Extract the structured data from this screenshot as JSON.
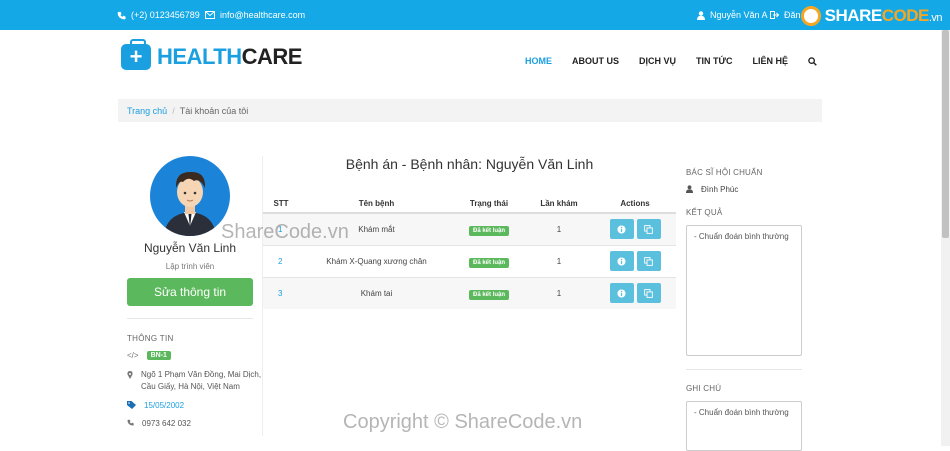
{
  "topbar": {
    "phone": "(+2) 0123456789",
    "email": "info@healthcare.com",
    "user": "Nguyễn Văn A",
    "logout": "Đăn"
  },
  "brand": {
    "logo_part1": "HEALTH",
    "logo_part2": "CARE"
  },
  "watermark_logo": {
    "part1": "SHARE",
    "part2": "CODE",
    "part3": ".vn"
  },
  "nav": {
    "items": [
      "HOME",
      "ABOUT US",
      "DỊCH VỤ",
      "TIN TỨC",
      "LIÊN HỆ"
    ],
    "active_index": 0
  },
  "breadcrumb": {
    "home": "Trang chủ",
    "separator": "/",
    "current": "Tài khoản của tôi"
  },
  "profile": {
    "name": "Nguyễn Văn Linh",
    "role": "Lập trình viên",
    "edit_button": "Sửa thông tin",
    "info_title": "THÔNG TIN",
    "code": "BN-1",
    "address": "Ngõ 1 Phạm Văn Đồng, Mai Dịch, Cầu Giấy, Hà Nội, Việt Nam",
    "birthday": "15/05/2002",
    "phone": "0973 642 032"
  },
  "main": {
    "title": "Bệnh án - Bệnh nhân: Nguyễn Văn Linh",
    "columns": [
      "STT",
      "Tên bệnh",
      "Trạng thái",
      "Lần khám",
      "Actions"
    ],
    "rows": [
      {
        "stt": "1",
        "name": "Khám mắt",
        "status": "Đã kết luận",
        "visits": "1"
      },
      {
        "stt": "2",
        "name": "Khám X-Quang xương chân",
        "status": "Đã kết luận",
        "visits": "1"
      },
      {
        "stt": "3",
        "name": "Khám tai",
        "status": "Đã kết luận",
        "visits": "1"
      }
    ]
  },
  "consult": {
    "doctor_label": "BÁC SĨ HỘI CHUẨN",
    "doctor_name": "Đình Phúc",
    "result_label": "KẾT QUẢ",
    "result_text": "- Chuẩn đoán bình thường",
    "note_label": "GHI CHÚ",
    "note_text": "- Chuẩn đoán bình thường"
  },
  "watermarks": {
    "center": "ShareCode.vn",
    "bottom": "Copyright © ShareCode.vn"
  },
  "colors": {
    "topbar": "#14a8e6",
    "accent": "#1a9fe0",
    "success": "#5cb85c",
    "info": "#5bc0de"
  }
}
